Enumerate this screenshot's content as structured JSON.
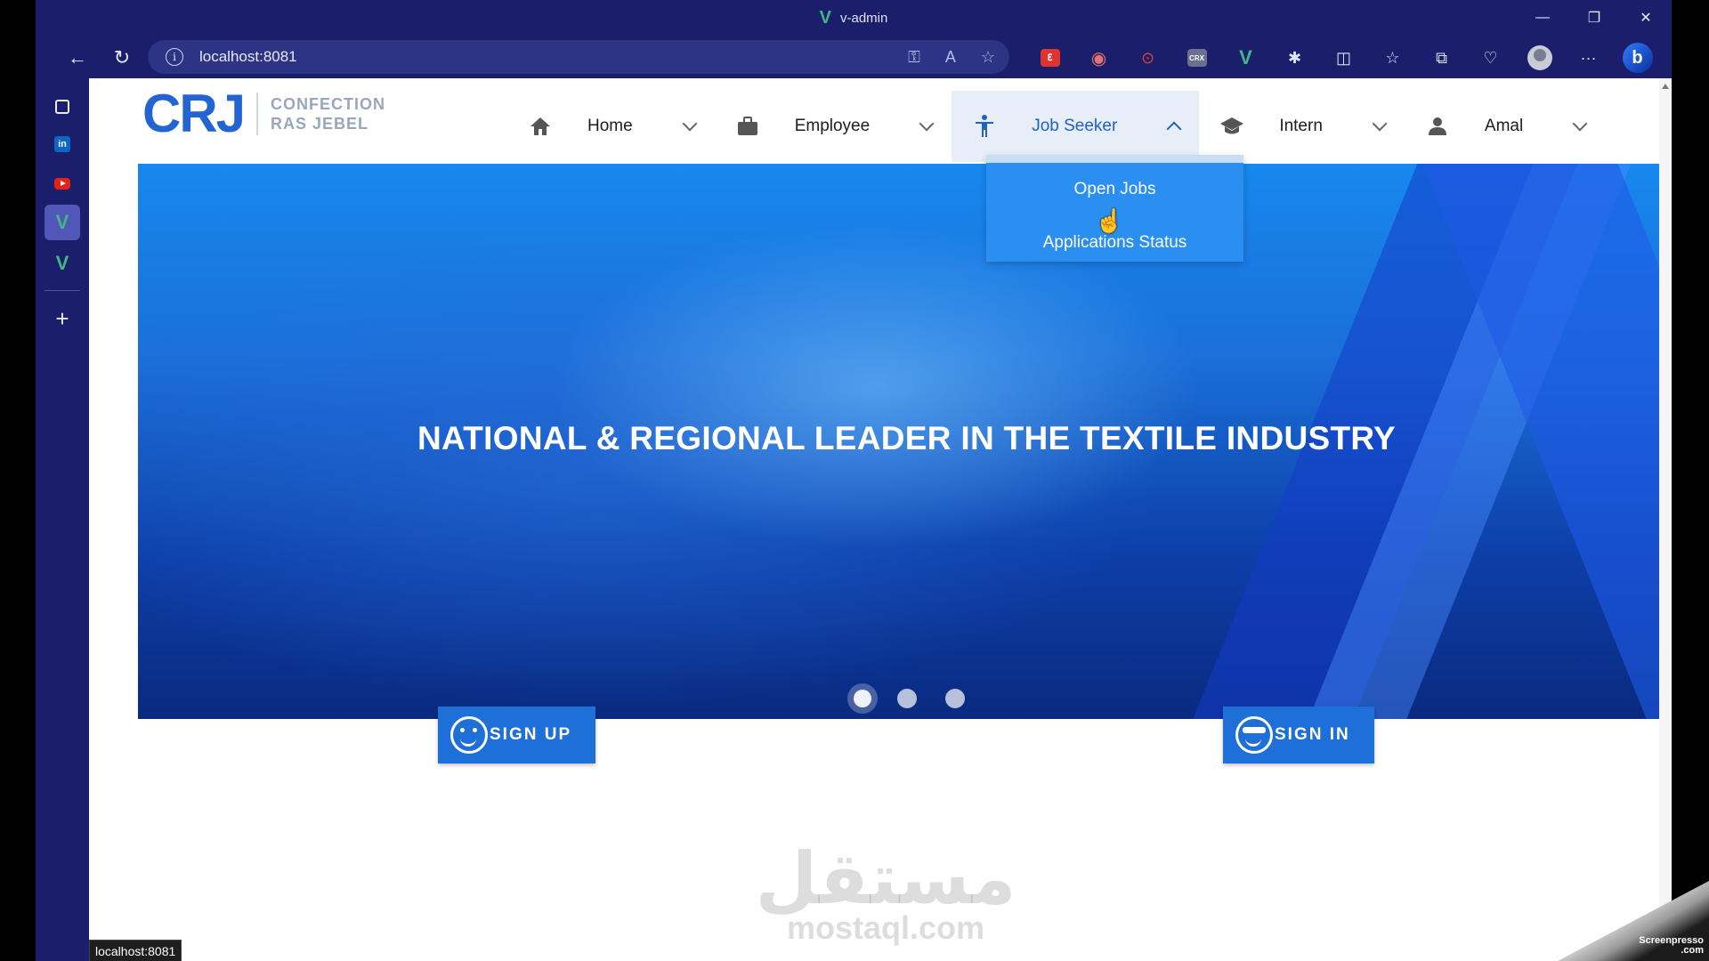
{
  "window": {
    "title": "v-admin",
    "minimize": "—",
    "maximize": "❐",
    "close": "✕"
  },
  "toolbar": {
    "back": "←",
    "reload": "↻",
    "address": "localhost:8081",
    "more": "···"
  },
  "extensions": [
    {
      "name": "translate-extension-icon",
      "glyph": "Ꜫ",
      "color": "#e0332f"
    },
    {
      "name": "spy-extension-icon",
      "glyph": "◉",
      "color": "#d9534f"
    },
    {
      "name": "record-extension-icon",
      "glyph": "▶",
      "color": "#e23b3b"
    },
    {
      "name": "crx-extension-icon",
      "glyph": "CRX",
      "color": "#8a8fa8"
    },
    {
      "name": "vue-devtools-icon",
      "glyph": "V",
      "color": "#41b883"
    }
  ],
  "site": {
    "logo": {
      "mark": "CRJ",
      "line1": "CONFECTION",
      "line2": "RAS JEBEL"
    },
    "menu": [
      {
        "id": "home",
        "label": "Home"
      },
      {
        "id": "employee",
        "label": "Employee"
      },
      {
        "id": "jobseeker",
        "label": "Job Seeker"
      },
      {
        "id": "intern",
        "label": "Intern"
      },
      {
        "id": "user",
        "label": "Amal"
      }
    ],
    "dropdown": [
      "Open Jobs",
      "Applications Status"
    ],
    "hero": {
      "headline": "NATIONAL & REGIONAL LEADER IN THE TEXTILE INDUSTRY",
      "slides": 3,
      "active_slide": 1
    },
    "buttons": {
      "signup": "SIGN UP",
      "signin": "SIGN IN"
    }
  },
  "watermark": {
    "arabic": "مستقل",
    "latin": "mostaql.com"
  },
  "status_url": "localhost:8081",
  "screenpresso": {
    "line1": "Screenpresso",
    "line2": ".com"
  },
  "colors": {
    "browser_chrome": "#1b1f6b",
    "brand_blue": "#2264d1",
    "button_blue": "#1f6fd8",
    "dropdown_blue": "#2a8ff0"
  }
}
